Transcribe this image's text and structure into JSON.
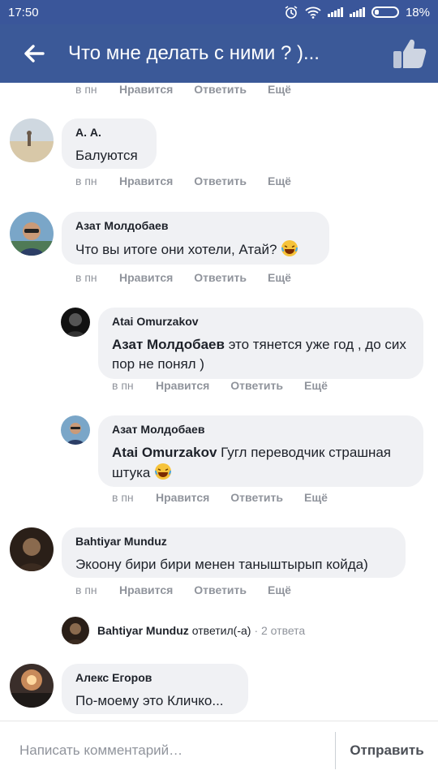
{
  "status": {
    "time": "17:50",
    "battery": "18%"
  },
  "header": {
    "title": "Что мне делать с ними ? )..."
  },
  "actions": {
    "time": "в пн",
    "like": "Нравится",
    "reply": "Ответить",
    "more": "Ещё"
  },
  "comments": [
    {
      "name": "А. А.",
      "text": "Балуются"
    },
    {
      "name": "Азат Молдобаев",
      "text": "Что вы итоге они хотели, Атай?"
    },
    {
      "name": "Atai Omurzakov",
      "mention": "Азат Молдобаев",
      "text": " это тянется уже год , до сих пор не понял )"
    },
    {
      "name": "Азат Молдобаев",
      "mention": "Atai Omurzakov",
      "text": " Гугл переводчик страшная штука"
    },
    {
      "name": "Bahtiyar Munduz",
      "text": "Экоону бири бири менен таныштырып койда)"
    },
    {
      "name": "Алекс Егоров",
      "text": "По-моему это Кличко..."
    }
  ],
  "replies_summary": {
    "author": "Bahtiyar Munduz",
    "verb": "ответил(-а)",
    "count": "· 2 ответа"
  },
  "composer": {
    "placeholder": "Написать комментарий…",
    "send": "Отправить"
  },
  "colors": {
    "header": "#3b5998",
    "bubble": "#f0f1f4",
    "meta": "#90949c"
  }
}
